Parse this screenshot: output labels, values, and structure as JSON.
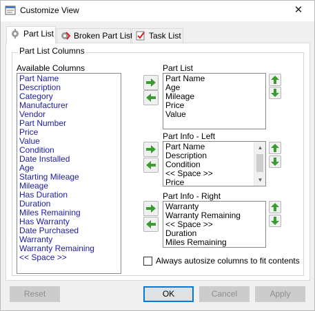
{
  "window": {
    "title": "Customize View",
    "close_glyph": "✕"
  },
  "tabs": [
    {
      "label": "Part List",
      "icon": "gear-icon"
    },
    {
      "label": "Broken Part List",
      "icon": "broken-gear-icon"
    },
    {
      "label": "Task List",
      "icon": "checklist-icon"
    }
  ],
  "group": {
    "label": "Part List Columns"
  },
  "available": {
    "label": "Available Columns",
    "items": [
      "Part Name",
      "Description",
      "Category",
      "Manufacturer",
      "Vendor",
      "Part Number",
      "Price",
      "Value",
      "Condition",
      "Date Installed",
      "Age",
      "Starting Mileage",
      "Mileage",
      "Has Duration",
      "Duration",
      "Miles Remaining",
      "Has Warranty",
      "Date Purchased",
      "Warranty",
      "Warranty Remaining",
      "<< Space >>"
    ]
  },
  "part_list": {
    "label": "Part List",
    "items": [
      "Part Name",
      "Age",
      "Mileage",
      "Price",
      "Value"
    ]
  },
  "info_left": {
    "label": "Part Info - Left",
    "items": [
      "Part Name",
      "Description",
      "Condition",
      "<< Space >>",
      "Price"
    ]
  },
  "info_right": {
    "label": "Part Info - Right",
    "items": [
      "Warranty",
      "Warranty Remaining",
      "<< Space >>",
      "Duration",
      "Miles Remaining"
    ]
  },
  "autosize": {
    "label": "Always autosize columns to fit contents",
    "checked": false
  },
  "buttons": {
    "reset": "Reset",
    "ok": "OK",
    "cancel": "Cancel",
    "apply": "Apply"
  },
  "colors": {
    "arrow_green": "#3a9b2e",
    "list_text_blue": "#1a1aa6",
    "focus_blue": "#0078d7"
  }
}
